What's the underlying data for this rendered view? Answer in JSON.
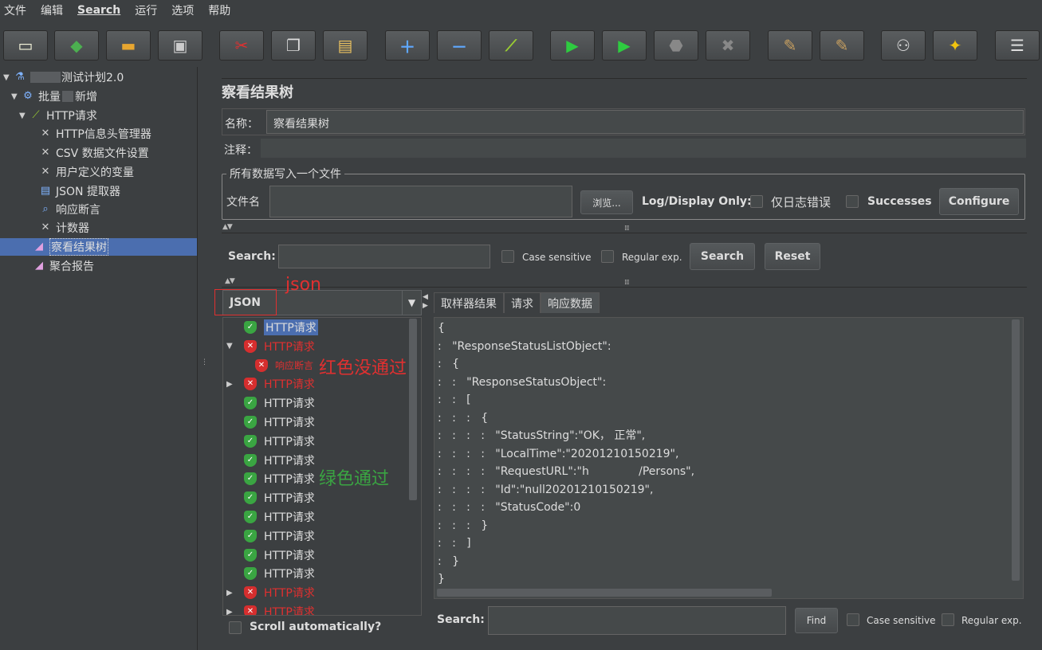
{
  "menu": [
    "文件",
    "编辑",
    "Search",
    "运行",
    "选项",
    "帮助"
  ],
  "tree": {
    "plan": "测试计划2.0",
    "group": "批量",
    "group_suffix": "新增",
    "http": "HTTP请求",
    "children": [
      "HTTP信息头管理器",
      "CSV 数据文件设置",
      "用户定义的变量",
      "JSON 提取器",
      "响应断言",
      "计数器"
    ],
    "results_tree": "察看结果树",
    "aggregate": "聚合报告"
  },
  "panel": {
    "title": "察看结果树",
    "name_label": "名称：",
    "name_value": "察看结果树",
    "comment_label": "注释：",
    "file_legend": "所有数据写入一个文件",
    "file_label": "文件名",
    "browse": "浏览...",
    "log_display": "Log/Display Only:",
    "errors_only": "仅日志错误",
    "successes": "Successes",
    "configure": "Configure"
  },
  "search": {
    "label": "Search:",
    "case": "Case sensitive",
    "regex": "Regular exp.",
    "search_btn": "Search",
    "reset_btn": "Reset"
  },
  "renderer": {
    "value": "JSON"
  },
  "results": [
    {
      "label": "HTTP请求",
      "status": "ok",
      "selected": true
    },
    {
      "label": "HTTP请求",
      "status": "fail",
      "expanded": true
    },
    {
      "label": "响应断言",
      "status": "fail",
      "child": true
    },
    {
      "label": "HTTP请求",
      "status": "fail",
      "collapsed": true
    },
    {
      "label": "HTTP请求",
      "status": "ok"
    },
    {
      "label": "HTTP请求",
      "status": "ok"
    },
    {
      "label": "HTTP请求",
      "status": "ok"
    },
    {
      "label": "HTTP请求",
      "status": "ok"
    },
    {
      "label": "HTTP请求",
      "status": "ok"
    },
    {
      "label": "HTTP请求",
      "status": "ok"
    },
    {
      "label": "HTTP请求",
      "status": "ok"
    },
    {
      "label": "HTTP请求",
      "status": "ok"
    },
    {
      "label": "HTTP请求",
      "status": "ok"
    },
    {
      "label": "HTTP请求",
      "status": "ok"
    },
    {
      "label": "HTTP请求",
      "status": "fail",
      "collapsed": true
    },
    {
      "label": "HTTP请求",
      "status": "fail",
      "collapsed": true
    }
  ],
  "tabs": [
    "取样器结果",
    "请求",
    "响应数据"
  ],
  "response_lines": [
    "{",
    ":   \"ResponseStatusListObject\":",
    ":   {",
    ":   :   \"ResponseStatusObject\":",
    ":   :   [",
    ":   :   :   {",
    ":   :   :   :   \"StatusString\":\"OK， 正常\",",
    ":   :   :   :   \"LocalTime\":\"20201210150219\",",
    ":   :   :   :   \"RequestURL\":\"h              /Persons\",",
    ":   :   :   :   \"Id\":\"null20201210150219\",",
    ":   :   :   :   \"StatusCode\":0",
    ":   :   :   }",
    ":   :   ]",
    ":   }",
    "}"
  ],
  "bottom": {
    "scroll_auto": "Scroll automatically?",
    "search_label": "Search:",
    "find": "Find",
    "case": "Case sensitive",
    "regex": "Regular exp."
  },
  "annotations": {
    "json": "json",
    "red": "红色没通过",
    "green": "绿色通过"
  }
}
